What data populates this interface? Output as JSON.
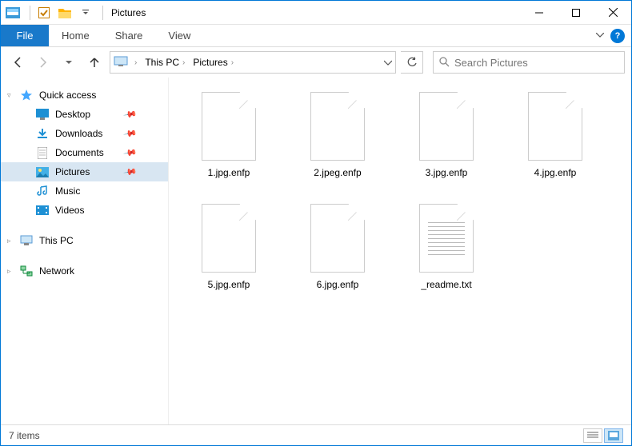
{
  "window": {
    "title": "Pictures"
  },
  "ribbon": {
    "file": "File",
    "tabs": [
      "Home",
      "Share",
      "View"
    ]
  },
  "breadcrumb": {
    "root": "This PC",
    "folder": "Pictures"
  },
  "search": {
    "placeholder": "Search Pictures"
  },
  "sidebar": {
    "quick": "Quick access",
    "pinned": [
      {
        "label": "Desktop"
      },
      {
        "label": "Downloads"
      },
      {
        "label": "Documents"
      },
      {
        "label": "Pictures",
        "selected": true
      },
      {
        "label": "Music"
      },
      {
        "label": "Videos"
      }
    ],
    "thispc": "This PC",
    "network": "Network"
  },
  "files": [
    {
      "name": "1.jpg.enfp",
      "type": "unknown"
    },
    {
      "name": "2.jpeg.enfp",
      "type": "unknown"
    },
    {
      "name": "3.jpg.enfp",
      "type": "unknown"
    },
    {
      "name": "4.jpg.enfp",
      "type": "unknown"
    },
    {
      "name": "5.jpg.enfp",
      "type": "unknown"
    },
    {
      "name": "6.jpg.enfp",
      "type": "unknown"
    },
    {
      "name": "_readme.txt",
      "type": "txt"
    }
  ],
  "status": {
    "count": "7 items"
  }
}
